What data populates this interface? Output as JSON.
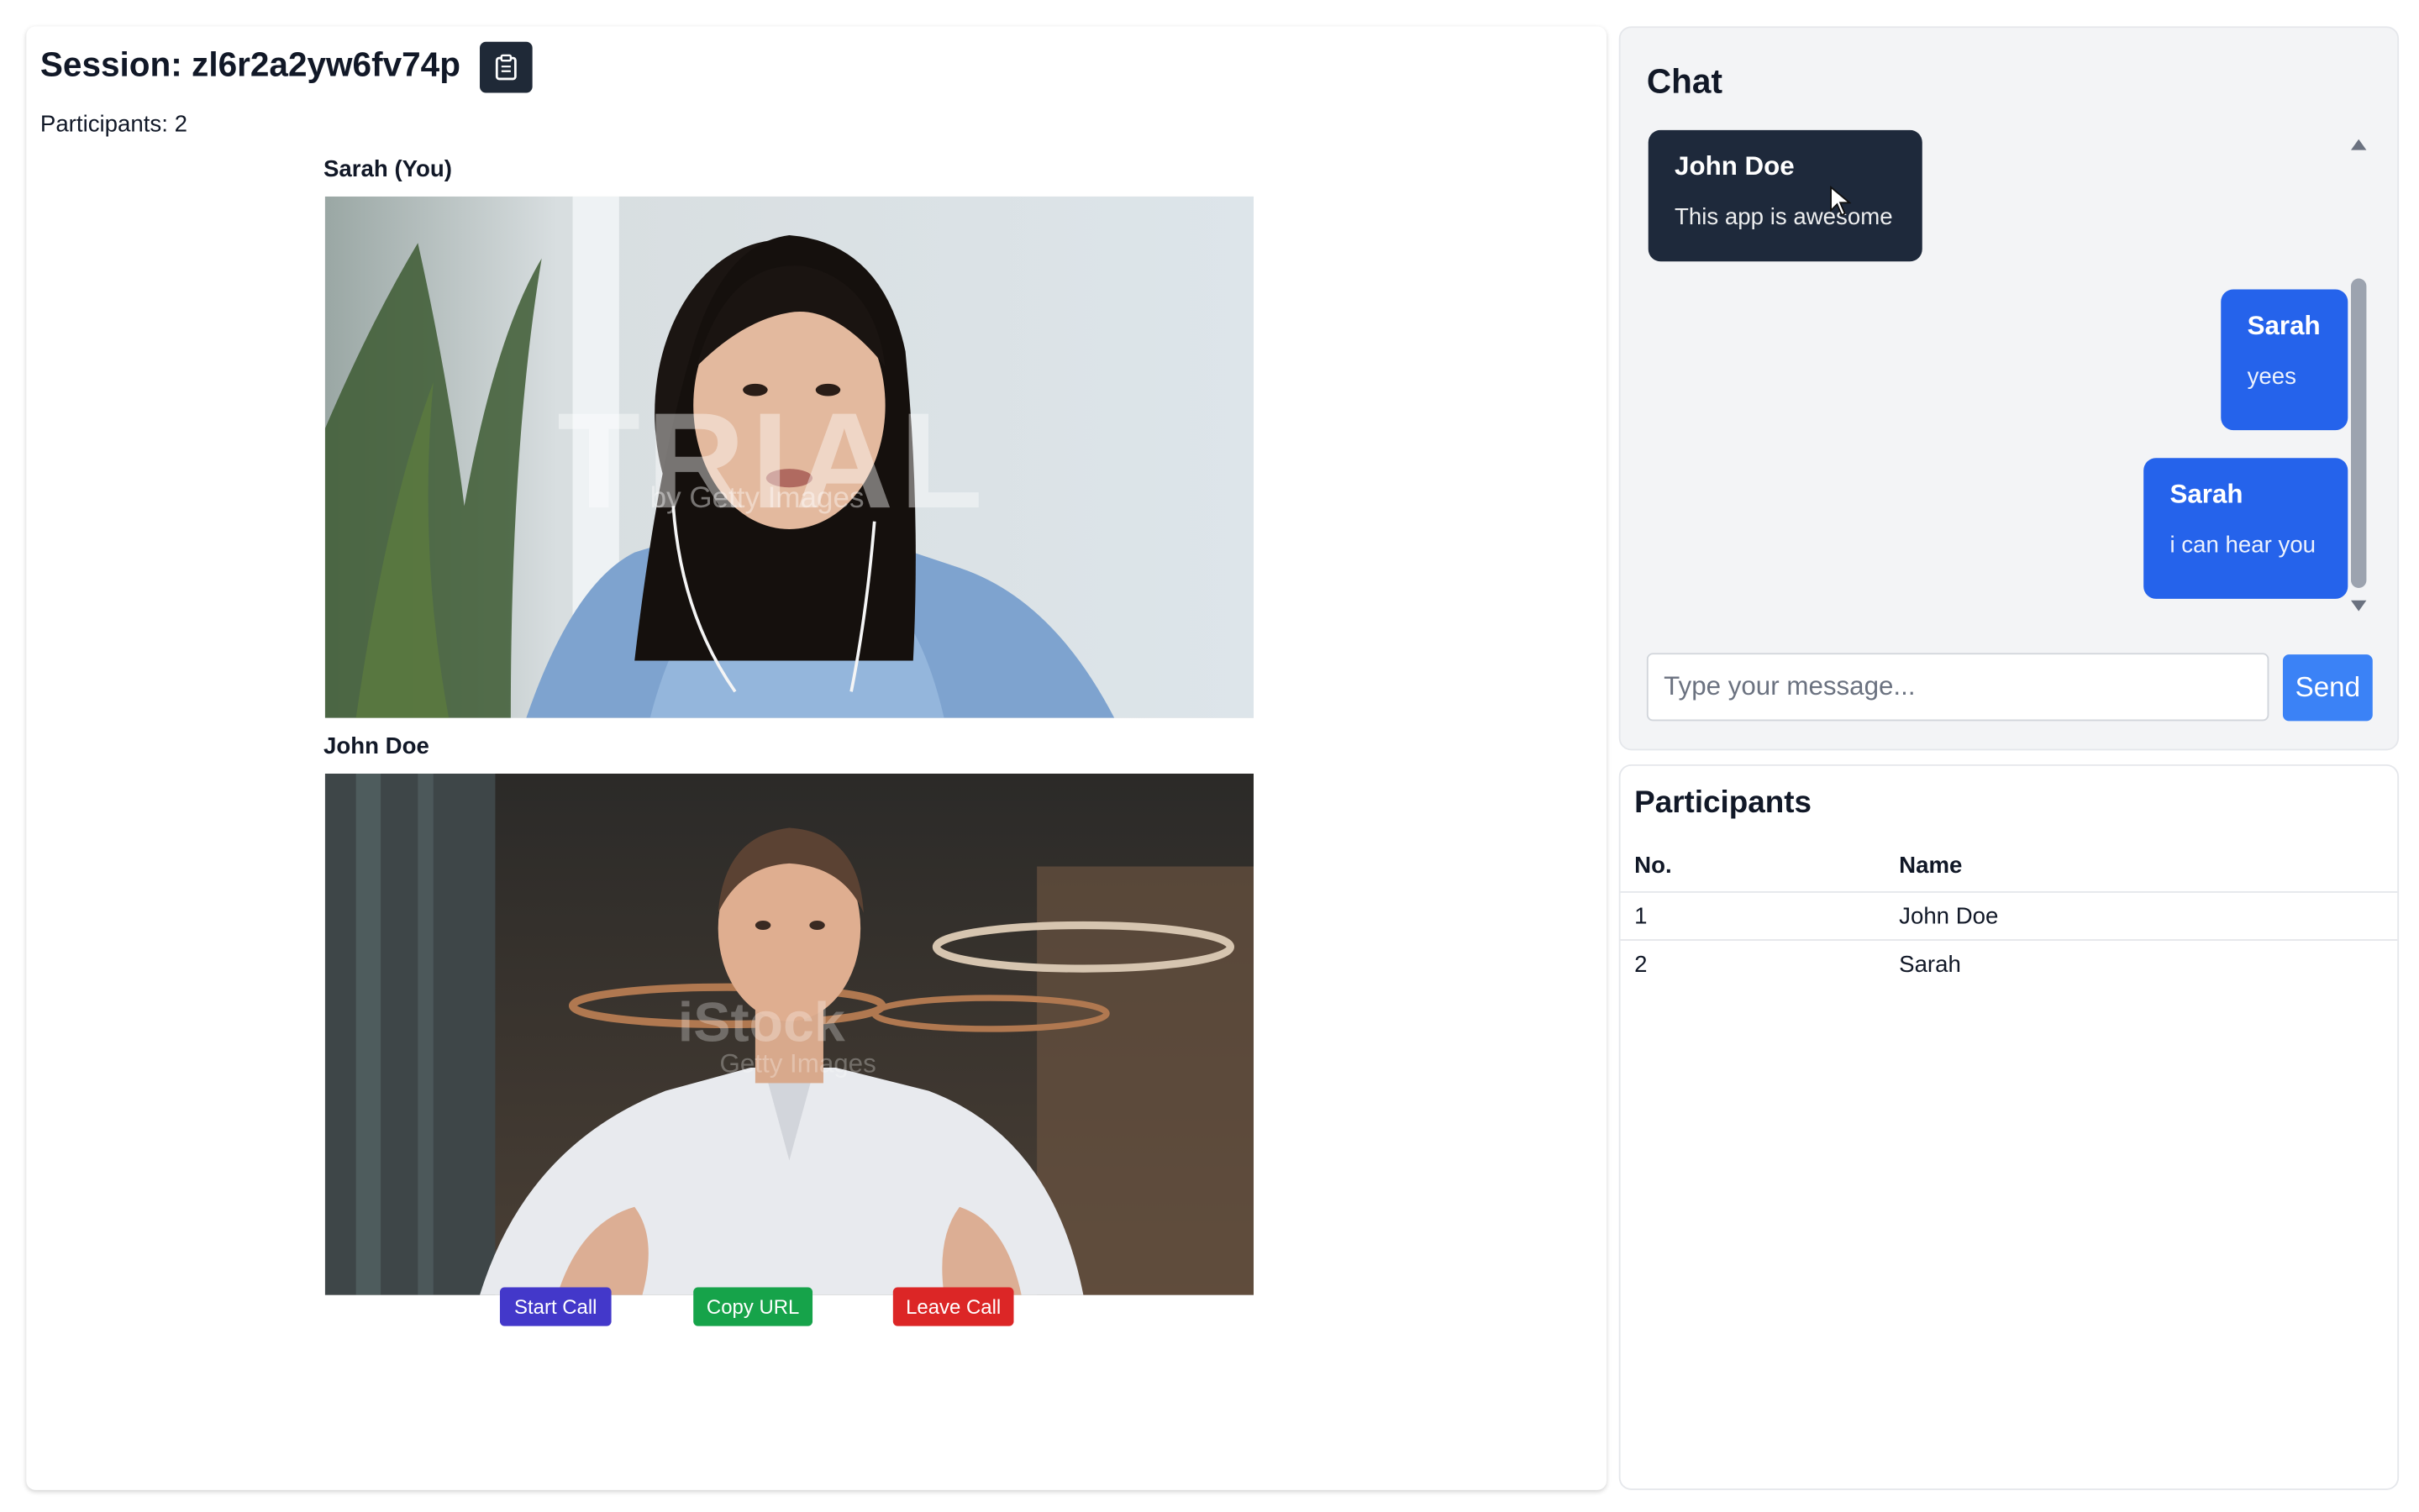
{
  "session": {
    "label": "Session: zl6r2a2yw6fv74p",
    "participants_count": "Participants: 2"
  },
  "videos": [
    {
      "label": "Sarah (You)",
      "watermark_big": "TRIAL",
      "watermark_small": "by Getty Images"
    },
    {
      "label": "John Doe",
      "watermark_big": "iStock",
      "watermark_small": "Getty Images"
    }
  ],
  "controls": {
    "start_call": "Start Call",
    "copy_url": "Copy URL",
    "leave_call": "Leave Call"
  },
  "chat": {
    "title": "Chat",
    "messages": [
      {
        "sender": "John Doe",
        "text": "This app is awesome",
        "self": false
      },
      {
        "sender": "Sarah",
        "text": "yees",
        "self": true
      },
      {
        "sender": "Sarah",
        "text": "i can hear you",
        "self": true
      }
    ],
    "input_placeholder": "Type your message...",
    "send_label": "Send"
  },
  "participants": {
    "title": "Participants",
    "columns": [
      "No.",
      "Name"
    ],
    "rows": [
      {
        "no": "1",
        "name": "John Doe"
      },
      {
        "no": "2",
        "name": "Sarah"
      }
    ]
  },
  "colors": {
    "start_call": "#4338ca",
    "copy_url": "#16a34a",
    "leave_call": "#dc2626",
    "own_message": "#2563eb",
    "other_message": "#1e293b",
    "send_button": "#3b82f6"
  },
  "icons": {
    "copy_session": "clipboard-icon",
    "scroll_up": "arrow-up-icon",
    "scroll_down": "arrow-down-icon",
    "cursor": "mouse-cursor-icon"
  }
}
